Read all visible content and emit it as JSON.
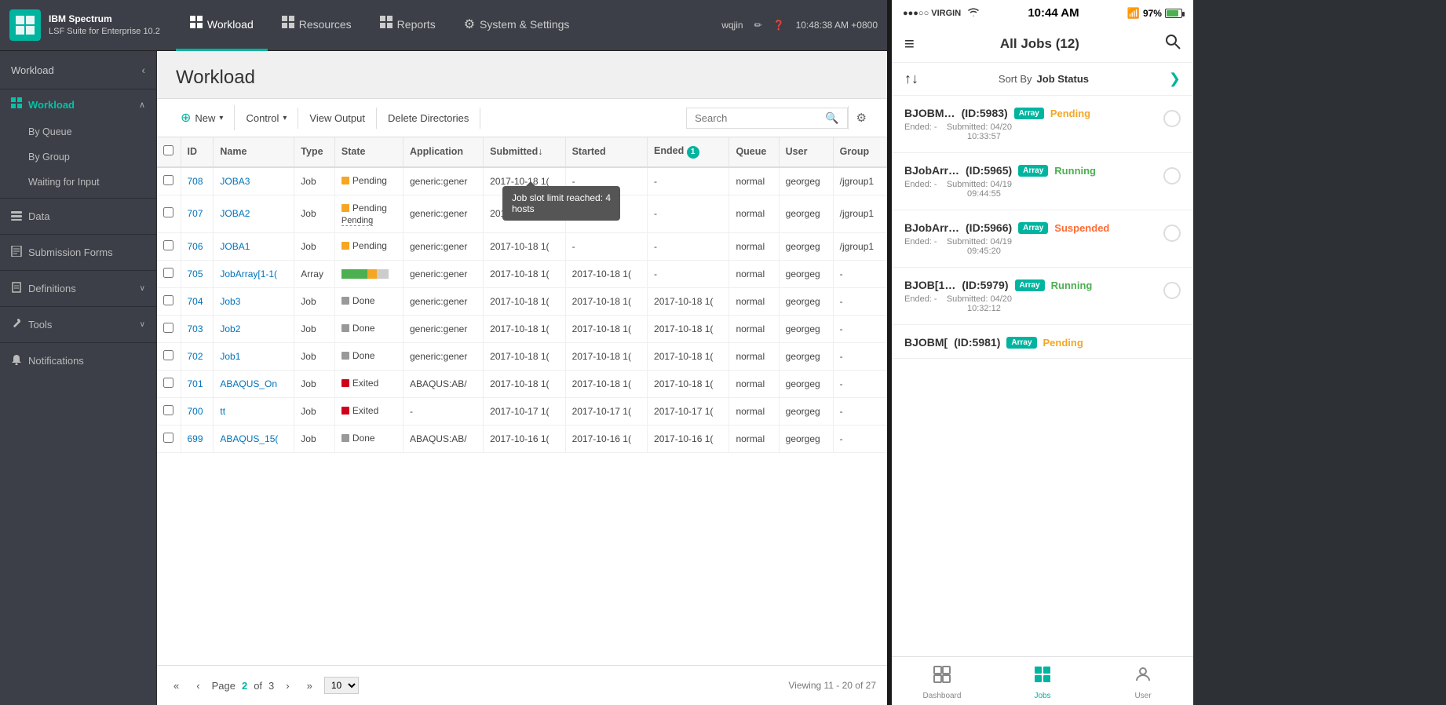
{
  "app": {
    "logo_line1": "IBM Spectrum",
    "logo_line2": "LSF Suite for Enterprise 10.2",
    "logo_icon": "⬛"
  },
  "nav": {
    "items": [
      {
        "label": "Workload",
        "icon": "⊞",
        "active": true
      },
      {
        "label": "Resources",
        "icon": "⊞"
      },
      {
        "label": "Reports",
        "icon": "⊞"
      },
      {
        "label": "System & Settings",
        "icon": "⚙"
      }
    ],
    "right": {
      "user": "wqjin",
      "pencil": "✏",
      "help": "?",
      "time": "10:48:38 AM +0800"
    }
  },
  "sidebar": {
    "header": "Workload",
    "collapse_label": "‹",
    "sections": [
      {
        "title": "Workload",
        "icon": "⊞",
        "expanded": true,
        "items": [
          "By Queue",
          "By Group",
          "Waiting for Input"
        ]
      }
    ],
    "links": [
      {
        "label": "Data",
        "icon": "🗄"
      },
      {
        "label": "Submission Forms",
        "icon": "📋"
      },
      {
        "label": "Definitions",
        "icon": "📖",
        "has_chevron": true
      },
      {
        "label": "Tools",
        "icon": "🔧",
        "has_chevron": true
      },
      {
        "label": "Notifications",
        "icon": "🔔"
      }
    ]
  },
  "main": {
    "title": "Workload",
    "toolbar": {
      "new_label": "New",
      "new_icon": "+",
      "control_label": "Control",
      "control_icon": "▾",
      "view_output_label": "View Output",
      "delete_dirs_label": "Delete Directories",
      "search_placeholder": "Search"
    },
    "table": {
      "columns": [
        "ID",
        "Name",
        "Type",
        "State",
        "Application",
        "Submitted↓",
        "Started",
        "Ended",
        "Queue",
        "User",
        "Group"
      ],
      "ended_badge": "1",
      "rows": [
        {
          "id": "708",
          "name": "JOBA3",
          "type": "Job",
          "state": "Pending",
          "state_type": "pending",
          "application": "generic:gener",
          "submitted": "2017-10-18 1(",
          "started": "-",
          "ended": "-",
          "queue": "normal",
          "user": "georgeg",
          "group": "/jgroup1",
          "has_tooltip": true
        },
        {
          "id": "707",
          "name": "JOBA2",
          "type": "Job",
          "state": "Pending",
          "state_type": "pending",
          "application": "generic:gener",
          "submitted": "2017-10-18 1(",
          "started": "-",
          "ended": "-",
          "queue": "normal",
          "user": "georgeg",
          "group": "/jgroup1",
          "has_pending_sub": true
        },
        {
          "id": "706",
          "name": "JOBA1",
          "type": "Job",
          "state": "Pending",
          "state_type": "pending",
          "application": "generic:gener",
          "submitted": "2017-10-18 1(",
          "started": "-",
          "ended": "-",
          "queue": "normal",
          "user": "georgeg",
          "group": "/jgroup1"
        },
        {
          "id": "705",
          "name": "JobArray[1-1(",
          "type": "Array",
          "state": "progress",
          "state_type": "progress",
          "application": "generic:gener",
          "submitted": "2017-10-18 1(",
          "started": "2017-10-18 1(",
          "ended": "-",
          "queue": "normal",
          "user": "georgeg",
          "group": "-"
        },
        {
          "id": "704",
          "name": "Job3",
          "type": "Job",
          "state": "Done",
          "state_type": "done",
          "application": "generic:gener",
          "submitted": "2017-10-18 1(",
          "started": "2017-10-18 1(",
          "ended": "2017-10-18 1(",
          "queue": "normal",
          "user": "georgeg",
          "group": "-"
        },
        {
          "id": "703",
          "name": "Job2",
          "type": "Job",
          "state": "Done",
          "state_type": "done",
          "application": "generic:gener",
          "submitted": "2017-10-18 1(",
          "started": "2017-10-18 1(",
          "ended": "2017-10-18 1(",
          "queue": "normal",
          "user": "georgeg",
          "group": "-"
        },
        {
          "id": "702",
          "name": "Job1",
          "type": "Job",
          "state": "Done",
          "state_type": "done",
          "application": "generic:gener",
          "submitted": "2017-10-18 1(",
          "started": "2017-10-18 1(",
          "ended": "2017-10-18 1(",
          "queue": "normal",
          "user": "georgeg",
          "group": "-"
        },
        {
          "id": "701",
          "name": "ABAQUS_On",
          "type": "Job",
          "state": "Exited",
          "state_type": "exited",
          "application": "ABAQUS:AB/",
          "submitted": "2017-10-18 1(",
          "started": "2017-10-18 1(",
          "ended": "2017-10-18 1(",
          "queue": "normal",
          "user": "georgeg",
          "group": "-"
        },
        {
          "id": "700",
          "name": "tt",
          "type": "Job",
          "state": "Exited",
          "state_type": "exited",
          "application": "-",
          "submitted": "2017-10-17 1(",
          "started": "2017-10-17 1(",
          "ended": "2017-10-17 1(",
          "queue": "normal",
          "user": "georgeg",
          "group": "-"
        },
        {
          "id": "699",
          "name": "ABAQUS_15(",
          "type": "Job",
          "state": "Done",
          "state_type": "done",
          "application": "ABAQUS:AB/",
          "submitted": "2017-10-16 1(",
          "started": "2017-10-16 1(",
          "ended": "2017-10-16 1(",
          "queue": "normal",
          "user": "georgeg",
          "group": "-"
        }
      ],
      "tooltip": {
        "text_line1": "Job slot limit reached: 4",
        "text_line2": "hosts"
      }
    },
    "pagination": {
      "page": "2",
      "total_pages": "3",
      "per_page": "10",
      "viewing": "Viewing 11 - 20 of 27"
    }
  },
  "mobile": {
    "status_bar": {
      "signal": "●●●○○ VIRGIN",
      "wifi": "wifi",
      "time": "10:44 AM",
      "bluetooth": "bluetooth",
      "battery": "97%"
    },
    "header": {
      "title": "All Jobs (12)",
      "menu_icon": "≡",
      "search_icon": "🔍"
    },
    "sort": {
      "arrows": "↑↓",
      "label": "Sort By",
      "value": "Job Status",
      "chevron": "❯"
    },
    "jobs": [
      {
        "title": "BJOBM…",
        "id": "ID:5983",
        "badge": "Array",
        "status": "Pending",
        "status_type": "pending",
        "ended": "Ended: -",
        "submitted": "Submitted: 04/20",
        "submitted_time": "10:33:57"
      },
      {
        "title": "BJobArr…",
        "id": "ID:5965",
        "badge": "Array",
        "status": "Running",
        "status_type": "running",
        "ended": "Ended: -",
        "submitted": "Submitted: 04/19",
        "submitted_time": "09:44:55"
      },
      {
        "title": "BJobArr…",
        "id": "ID:5966",
        "badge": "Array",
        "status": "Suspended",
        "status_type": "suspended",
        "ended": "Ended: -",
        "submitted": "Submitted: 04/19",
        "submitted_time": "09:45:20"
      },
      {
        "title": "BJOB[1…",
        "id": "ID:5979",
        "badge": "Array",
        "status": "Running",
        "status_type": "running",
        "ended": "Ended: -",
        "submitted": "Submitted: 04/20",
        "submitted_time": "10:32:12"
      },
      {
        "title": "BJOBM[",
        "id": "ID:5981",
        "badge": "Array",
        "status": "Pending",
        "status_type": "pending",
        "ended": "",
        "submitted": "",
        "submitted_time": "",
        "partial": true
      }
    ],
    "bottom_nav": [
      {
        "label": "Dashboard",
        "icon": "dashboard",
        "active": false
      },
      {
        "label": "Jobs",
        "icon": "jobs",
        "active": true
      },
      {
        "label": "User",
        "icon": "user",
        "active": false
      }
    ]
  }
}
